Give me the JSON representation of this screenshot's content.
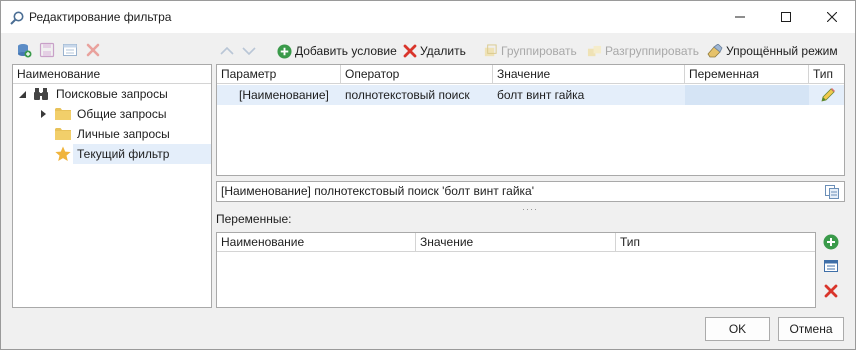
{
  "window": {
    "title": "Редактирование фильтра"
  },
  "left_toolbar": {
    "icons": [
      "add-query-icon",
      "save-icon",
      "properties-icon",
      "delete-icon"
    ]
  },
  "tree": {
    "header": "Наименование",
    "root": "Поисковые запросы",
    "items": [
      {
        "label": "Общие запросы",
        "icon": "folder-icon",
        "expandable": true
      },
      {
        "label": "Личные запросы",
        "icon": "folder-icon",
        "expandable": false
      },
      {
        "label": "Текущий фильтр",
        "icon": "star-icon",
        "selected": true
      }
    ]
  },
  "toolbar": {
    "add_label": "Добавить условие",
    "delete_label": "Удалить",
    "group_label": "Группировать",
    "ungroup_label": "Разгруппировать",
    "simple_mode_label": "Упрощённый режим"
  },
  "conditions": {
    "columns": [
      "Параметр",
      "Оператор",
      "Значение",
      "Переменная",
      "Тип"
    ],
    "rows": [
      {
        "param": "[Наименование]",
        "operator": "полнотекстовый поиск",
        "value": "болт винт гайка",
        "variable": "",
        "type_icon": "pencil-icon"
      }
    ]
  },
  "expression": {
    "text": "[Наименование] полнотекстовый поиск 'болт винт гайка'",
    "splitter": "····"
  },
  "variables": {
    "label": "Переменные:",
    "columns": [
      "Наименование",
      "Значение",
      "Тип"
    ]
  },
  "buttons": {
    "ok": "OK",
    "cancel": "Отмена"
  },
  "colors": {
    "selection": "#e4eefa",
    "add_green": "#3a9a4a",
    "delete_red": "#d9352b",
    "folder": "#e8c25a",
    "star": "#f0b43c"
  }
}
